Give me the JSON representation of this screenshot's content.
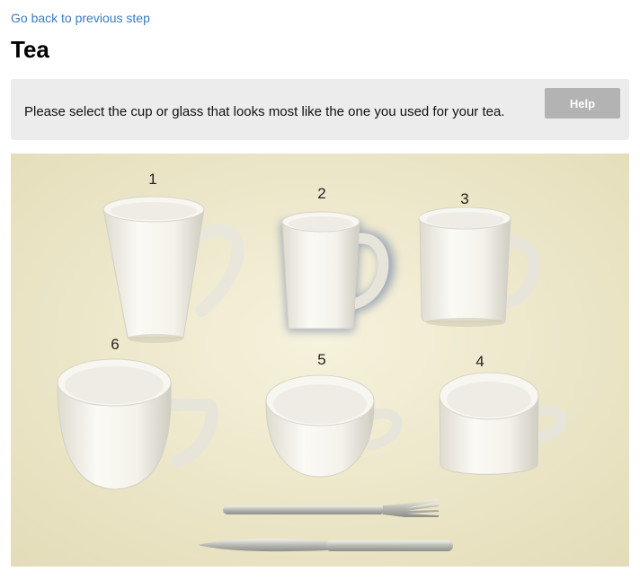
{
  "nav": {
    "back_label": "Go back to previous step"
  },
  "page": {
    "title": "Tea"
  },
  "instructions": {
    "text": "Please select the cup or glass that looks most like the one you used for your tea.",
    "help_label": "Help"
  },
  "cups": [
    {
      "number": "1"
    },
    {
      "number": "2"
    },
    {
      "number": "3"
    },
    {
      "number": "4"
    },
    {
      "number": "5"
    },
    {
      "number": "6"
    }
  ],
  "colors": {
    "link": "#3b7bbf",
    "panel": "#ececec",
    "help_button": "#b3b3b3",
    "photo_background": "#efe9cf"
  }
}
